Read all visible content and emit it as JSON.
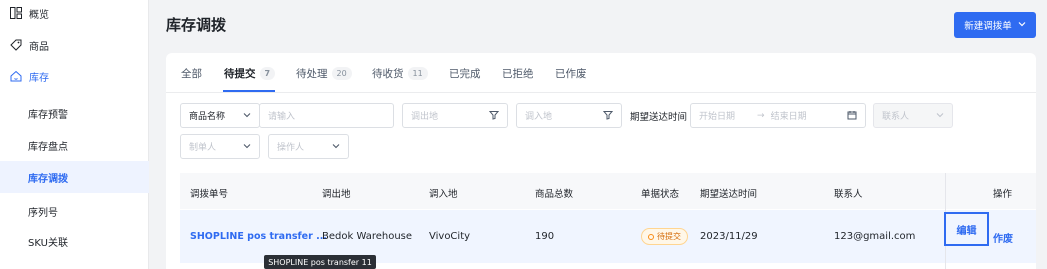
{
  "sidebar": {
    "items": [
      {
        "label": "概览",
        "icon": "dashboard-icon"
      },
      {
        "label": "商品",
        "icon": "tag-icon"
      },
      {
        "label": "库存",
        "icon": "house-icon"
      },
      {
        "label": "库存预警"
      },
      {
        "label": "库存盘点"
      },
      {
        "label": "库存调拨"
      },
      {
        "label": "序列号"
      },
      {
        "label": "SKU关联"
      }
    ]
  },
  "header": {
    "title": "库存调拨",
    "new_button": "新建调拨单"
  },
  "tabs": [
    {
      "label": "全部"
    },
    {
      "label": "待提交",
      "count": "7"
    },
    {
      "label": "待处理",
      "count": "20"
    },
    {
      "label": "待收货",
      "count": "11"
    },
    {
      "label": "已完成"
    },
    {
      "label": "已拒绝"
    },
    {
      "label": "已作废"
    }
  ],
  "filters": {
    "product_field": "商品名称",
    "search_placeholder": "请输入",
    "from_placeholder": "调出地",
    "to_placeholder": "调入地",
    "date_label": "期望送达时间",
    "start_date_placeholder": "开始日期",
    "end_date_placeholder": "结束日期",
    "contact_placeholder": "联系人",
    "creator_placeholder": "制单人",
    "operator_placeholder": "操作人"
  },
  "table": {
    "headers": [
      "调拨单号",
      "调出地",
      "调入地",
      "商品总数",
      "单据状态",
      "期望送达时间",
      "联系人",
      "操作"
    ],
    "row": {
      "order_no": "SHOPLINE pos transfer ...",
      "from": "Bedok Warehouse",
      "to": "VivoCity",
      "total": "190",
      "status": "待提交",
      "expected_date": "2023/11/29",
      "contact": "123@gmail.com",
      "edit": "编辑",
      "void": "作废"
    }
  },
  "tooltip": "SHOPLINE pos transfer 11",
  "colors": {
    "accent": "#2f6bf1",
    "status_pending": "#fa8c16"
  }
}
